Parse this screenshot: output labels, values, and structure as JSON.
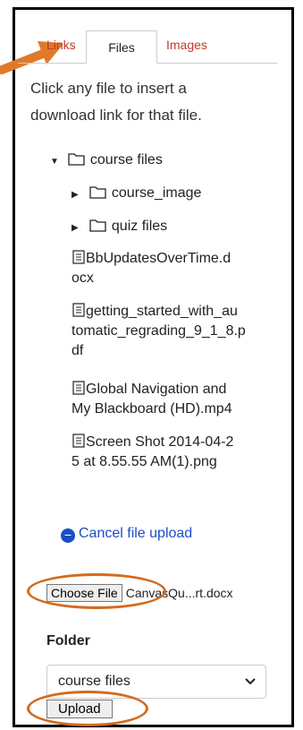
{
  "tabs": {
    "links": "Links",
    "files": "Files",
    "images": "Images"
  },
  "instructions": "Click any file to insert a download link for that file.",
  "tree": {
    "root": "course files",
    "folders": [
      "course_image",
      "quiz files"
    ],
    "files": [
      {
        "lines": [
          "BbUpdatesOverTime.d",
          "ocx"
        ]
      },
      {
        "lines": [
          "getting_started_with_au",
          "tomatic_regrading_9_1_8.p",
          "df"
        ]
      },
      {
        "lines": [
          "Global Navigation and",
          "My Blackboard (HD).mp4"
        ]
      },
      {
        "lines": [
          "Screen Shot 2014-04-2",
          "5 at 8.55.55 AM(1).png"
        ]
      }
    ]
  },
  "cancel_upload": "Cancel file upload",
  "file_input": {
    "button": "Choose File",
    "filename": "CanvasQu...rt.docx"
  },
  "folder": {
    "label": "Folder",
    "selected": "course files"
  },
  "upload_button": "Upload",
  "colors": {
    "accent": "#1a4fc4",
    "annotation": "#e07a2a",
    "tab_link": "#c0392b"
  }
}
